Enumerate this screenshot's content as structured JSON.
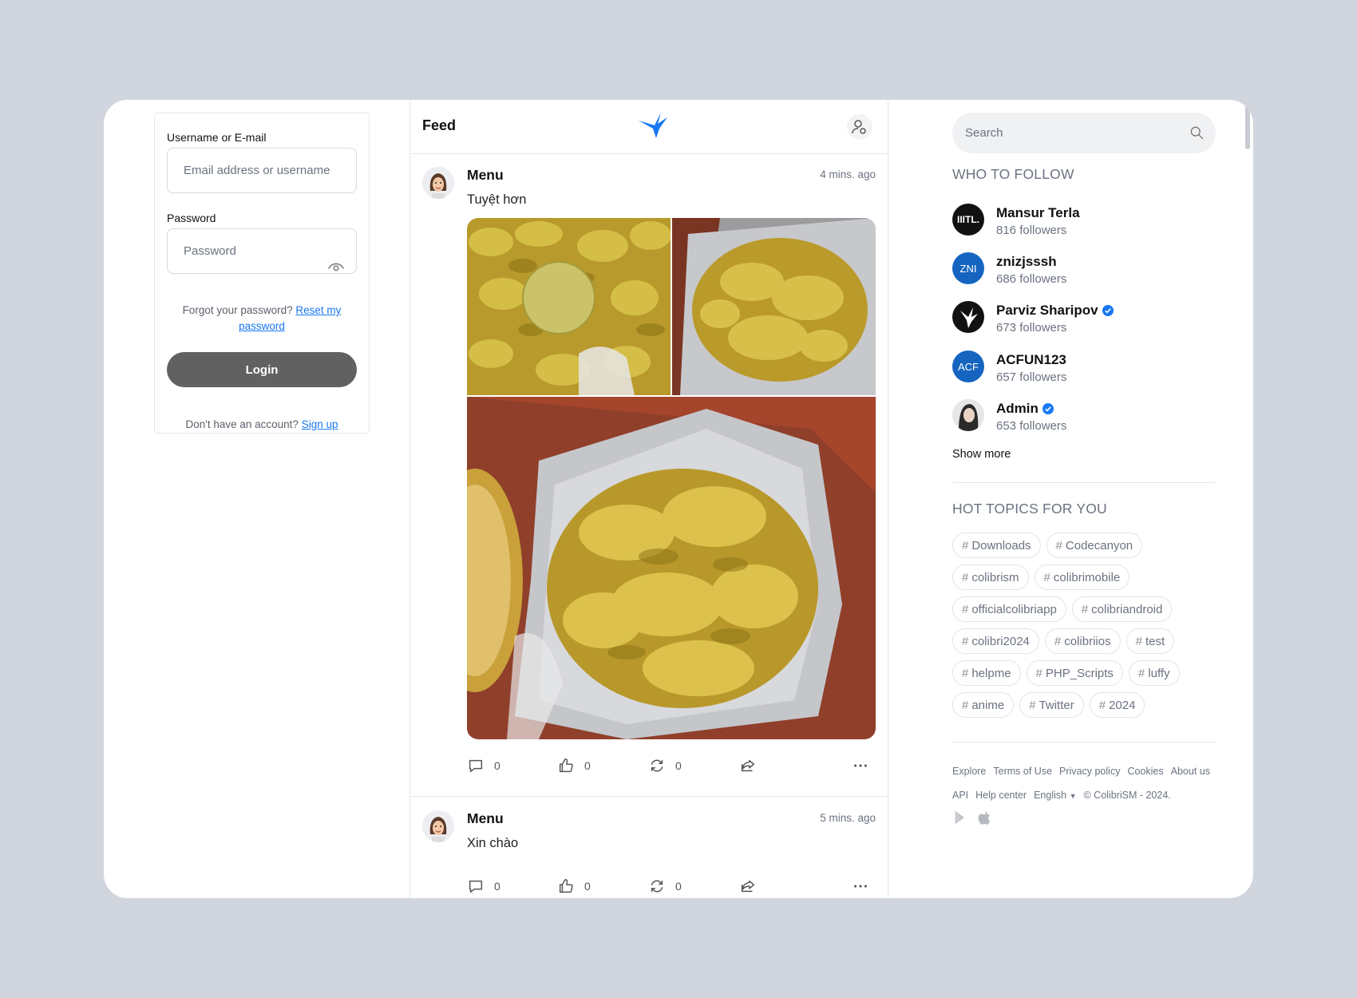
{
  "login": {
    "username_label": "Username or E-mail",
    "username_placeholder": "Email address or username",
    "password_label": "Password",
    "password_placeholder": "Password",
    "forgot_text": "Forgot your password?",
    "reset_link": "Reset my password",
    "login_button": "Login",
    "no_account_text": "Don't have an account?",
    "signup_link": "Sign up"
  },
  "feed": {
    "title": "Feed",
    "posts": [
      {
        "author": "Menu",
        "time": "4 mins. ago",
        "text": "Tuyệt hơn",
        "comments": "0",
        "likes": "0",
        "reposts": "0"
      },
      {
        "author": "Menu",
        "time": "5 mins. ago",
        "text": "Xin chào",
        "comments": "0",
        "likes": "0",
        "reposts": "0"
      }
    ]
  },
  "sidebar": {
    "search_placeholder": "Search",
    "who_to_follow_title": "WHO TO FOLLOW",
    "follow": [
      {
        "name": "Mansur Terla",
        "followers": "816 followers",
        "avatar_text": "IIITL.",
        "verified": false,
        "avatar_color": "#111111"
      },
      {
        "name": "znizjsssh",
        "followers": "686 followers",
        "avatar_text": "ZNI",
        "verified": false,
        "avatar_color": "#1565c0"
      },
      {
        "name": "Parviz Sharipov",
        "followers": "673 followers",
        "avatar_text": "",
        "verified": true,
        "avatar_color": "#111111"
      },
      {
        "name": "ACFUN123",
        "followers": "657 followers",
        "avatar_text": "ACF",
        "verified": false,
        "avatar_color": "#1565c0"
      },
      {
        "name": "Admin",
        "followers": "653 followers",
        "avatar_text": "",
        "verified": true,
        "avatar_color": "#d9d9d9"
      }
    ],
    "show_more": "Show more",
    "hot_topics_title": "HOT TOPICS FOR YOU",
    "topics": [
      "Downloads",
      "Codecanyon",
      "colibrism",
      "colibrimobile",
      "officialcolibriapp",
      "colibriandroid",
      "colibri2024",
      "colibriios",
      "test",
      "helpme",
      "PHP_Scripts",
      "luffy",
      "anime",
      "Twitter",
      "2024"
    ],
    "footer": [
      "Explore",
      "Terms of Use",
      "Privacy policy",
      "Cookies",
      "About us",
      "API",
      "Help center",
      "English",
      "© ColibriSM - 2024."
    ]
  },
  "colors": {
    "accent": "#1877f2",
    "login_button": "#616161",
    "verified": "#1877f2"
  }
}
